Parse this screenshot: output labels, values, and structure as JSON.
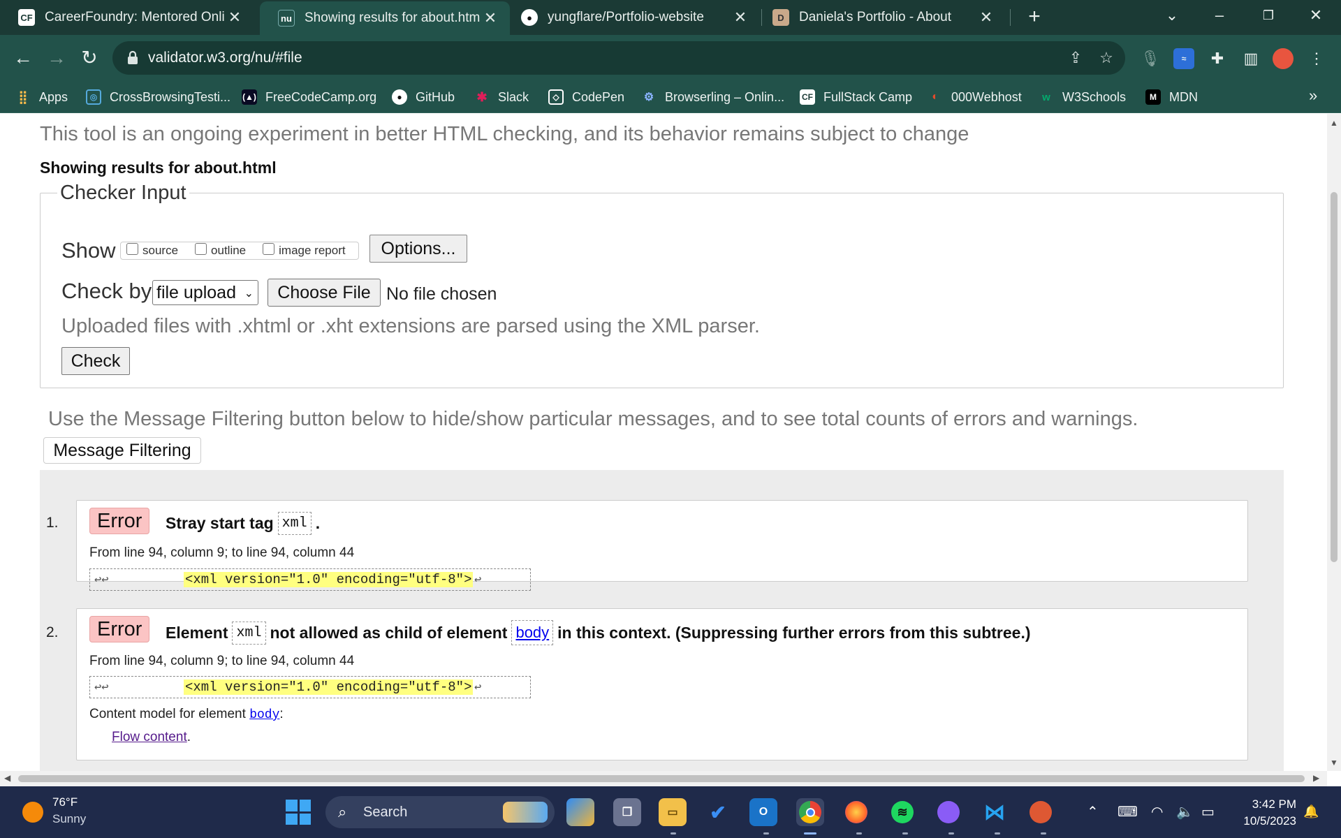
{
  "browser": {
    "tabs": [
      {
        "title": "CareerFoundry: Mentored Onlin",
        "icon": "careerfoundry-icon",
        "active": false
      },
      {
        "title": "Showing results for about.html -",
        "icon": "nu-validator-icon",
        "active": true
      },
      {
        "title": "yungflare/Portfolio-website",
        "icon": "github-icon",
        "active": false
      },
      {
        "title": "Daniela's Portfolio - About",
        "icon": "portfolio-icon",
        "active": false
      }
    ],
    "url": "validator.w3.org/nu/#file",
    "bookmarks": [
      {
        "label": "Apps",
        "icon": "apps-grid-icon"
      },
      {
        "label": "CrossBrowsingTesti...",
        "icon": "crossbrowser-icon"
      },
      {
        "label": "FreeCodeCamp.org",
        "icon": "freecodecamp-icon"
      },
      {
        "label": "GitHub",
        "icon": "github-icon"
      },
      {
        "label": "Slack",
        "icon": "slack-icon"
      },
      {
        "label": "CodePen",
        "icon": "codepen-icon"
      },
      {
        "label": "Browserling – Onlin...",
        "icon": "browserling-icon"
      },
      {
        "label": "FullStack Camp",
        "icon": "fullstack-camp-icon"
      },
      {
        "label": "000Webhost",
        "icon": "webhost-icon"
      },
      {
        "label": "W3Schools",
        "icon": "w3schools-icon"
      },
      {
        "label": "MDN",
        "icon": "mdn-icon"
      }
    ]
  },
  "page": {
    "intro": "This tool is an ongoing experiment in better HTML checking, and its behavior remains subject to change",
    "showing": "Showing results for about.html",
    "checker": {
      "legend": "Checker Input",
      "show_label": "Show",
      "show_options": [
        "source",
        "outline",
        "image report"
      ],
      "options_button": "Options...",
      "check_by_label": "Check by",
      "check_by_value": "file upload",
      "choose_file": "Choose File",
      "no_file": "No file chosen",
      "xml_note": "Uploaded files with .xhtml or .xht extensions are parsed using the XML parser.",
      "check_button": "Check"
    },
    "filter_note": "Use the Message Filtering button below to hide/show particular messages, and to see total counts of errors and warnings.",
    "filter_button": "Message Filtering",
    "messages": [
      {
        "num": "1.",
        "type": "Error",
        "text_a": "Stray start tag",
        "code_a": "xml",
        "text_b": ".",
        "location": "From line 94, column 9; to line 94, column 44",
        "extract_nl": "↩↩",
        "extract_code": "<xml version=\"1.0\" encoding=\"utf-8\">",
        "extract_end": "↩"
      },
      {
        "num": "2.",
        "type": "Error",
        "text_a": "Element",
        "code_a": "xml",
        "text_b": "not allowed as child of element",
        "link_b": "body",
        "text_c": "in this context. (Suppressing further errors from this subtree.)",
        "location": "From line 94, column 9; to line 94, column 44",
        "extract_nl": "↩↩",
        "extract_code": "<xml version=\"1.0\" encoding=\"utf-8\">",
        "extract_end": "↩",
        "content_model_label": "Content model for element",
        "content_model_link": "body",
        "content_model_colon": ":",
        "flow_link": "Flow content",
        "flow_period": "."
      }
    ]
  },
  "taskbar": {
    "temperature": "76°F",
    "condition": "Sunny",
    "search_placeholder": "Search",
    "time": "3:42 PM",
    "date": "10/5/2023",
    "apps": [
      "copilot-icon",
      "task-view-icon",
      "file-explorer-icon",
      "todo-icon",
      "outlook-icon",
      "chrome-icon",
      "firefox-icon",
      "spotify-icon",
      "github-desktop-icon",
      "vscode-icon",
      "duckduckgo-icon"
    ]
  },
  "colors": {
    "browser_frame": "#1b3a35",
    "toolbar": "#22524a",
    "error_badge": "#fbc4c4",
    "code_highlight": "#ffff80",
    "taskbar": "#1f2a4a"
  }
}
